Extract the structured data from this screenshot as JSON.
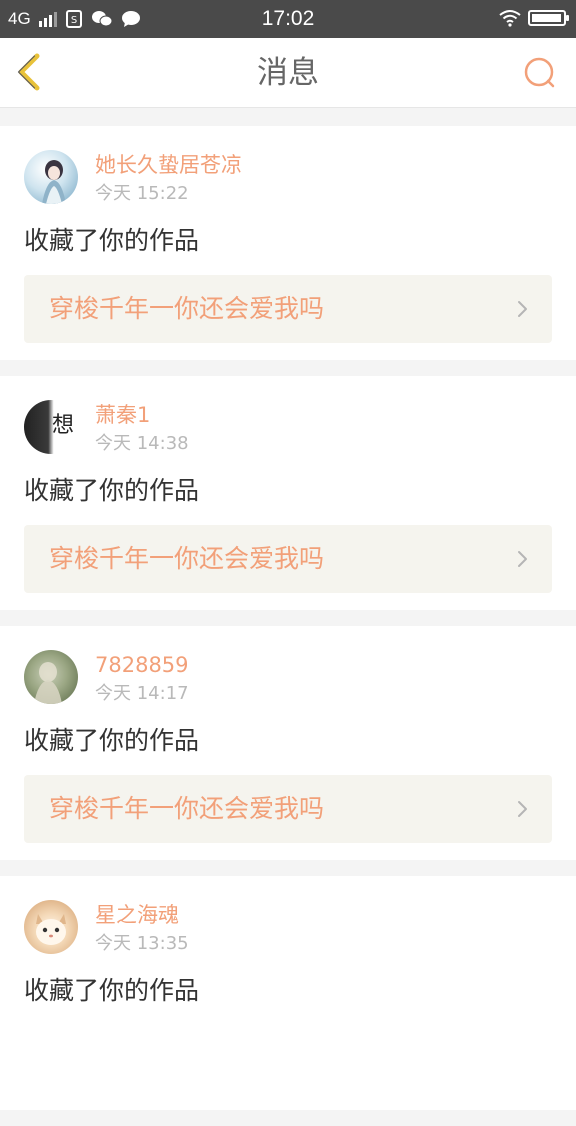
{
  "status_bar": {
    "network": "4G",
    "time": "17:02",
    "battery_level": 0.95,
    "icons": [
      "signal-icon",
      "sim-icon",
      "wechat-icon",
      "chat-bubble-icon",
      "wifi-icon",
      "battery-icon"
    ]
  },
  "header": {
    "title": "消息",
    "back_icon": "chevron-left-icon",
    "search_icon": "search-icon"
  },
  "theme": {
    "accent": "#f2a079",
    "back_arrow": "#e8c23a",
    "card_bg": "#ffffff",
    "page_bg": "#f4f4f4",
    "work_bg": "#f5f4ee"
  },
  "notifications": [
    {
      "username": "她长久蛰居苍凉",
      "time": "今天 15:22",
      "action": "收藏了你的作品",
      "work_title": "穿梭千年一你还会爱我吗"
    },
    {
      "username": "萧秦1",
      "time": "今天 14:38",
      "action": "收藏了你的作品",
      "work_title": "穿梭千年一你还会爱我吗",
      "avatar_text": "想"
    },
    {
      "username": "7828859",
      "time": "今天 14:17",
      "action": "收藏了你的作品",
      "work_title": "穿梭千年一你还会爱我吗"
    },
    {
      "username": "星之海魂",
      "time": "今天 13:35",
      "action": "收藏了你的作品",
      "work_title": ""
    }
  ]
}
